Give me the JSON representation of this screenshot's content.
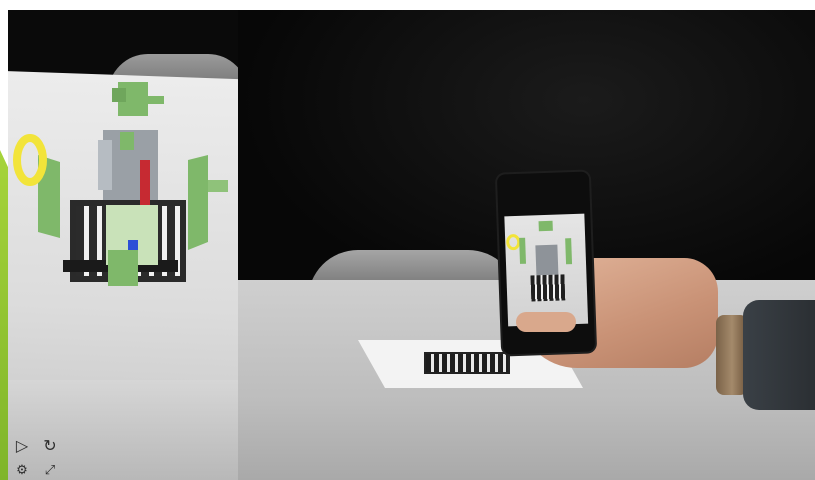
{
  "panels": {
    "left": {
      "label": "",
      "controls": [
        {
          "name": "play",
          "glyph": "▷"
        },
        {
          "name": "reset",
          "glyph": "↻"
        },
        {
          "name": "settings",
          "glyph": "⚙"
        },
        {
          "name": "fullscreen",
          "glyph": "⤢"
        }
      ]
    },
    "right": {
      "label": ""
    }
  },
  "colors": {
    "accent": "#8cc63f",
    "model_green": "#7fb86a",
    "model_yellow": "#f2e43a",
    "model_red": "#c62a32",
    "model_blue": "#2c4fd6"
  }
}
